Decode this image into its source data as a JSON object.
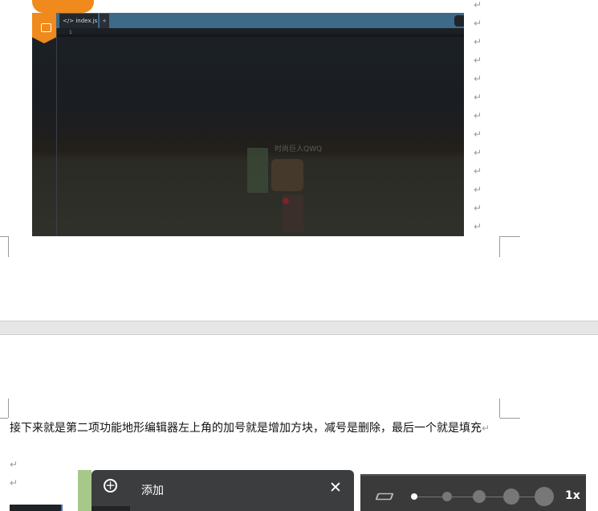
{
  "editor": {
    "tab_label": "</> index.js",
    "tab_add": "+",
    "line_number": "1",
    "overlay_text": "时尚巨人QWQ"
  },
  "return_mark": "↵",
  "document": {
    "paragraph": "接下来就是第二项功能地形编辑器左上角的加号就是增加方块，减号是删除，最后一个就是填充"
  },
  "add_panel": {
    "icon": "plus-circle-icon",
    "title": "添加",
    "close_icon": "close-icon"
  },
  "zoom_panel": {
    "layer_icon": "layers-icon",
    "selected_step": 1,
    "steps": 5,
    "label": "1x"
  },
  "colors": {
    "accent_orange": "#f08a1c",
    "editor_title_blue": "#3e6a8a",
    "panel_dark": "#3c3d3f",
    "green_strip": "#a6c98a"
  }
}
